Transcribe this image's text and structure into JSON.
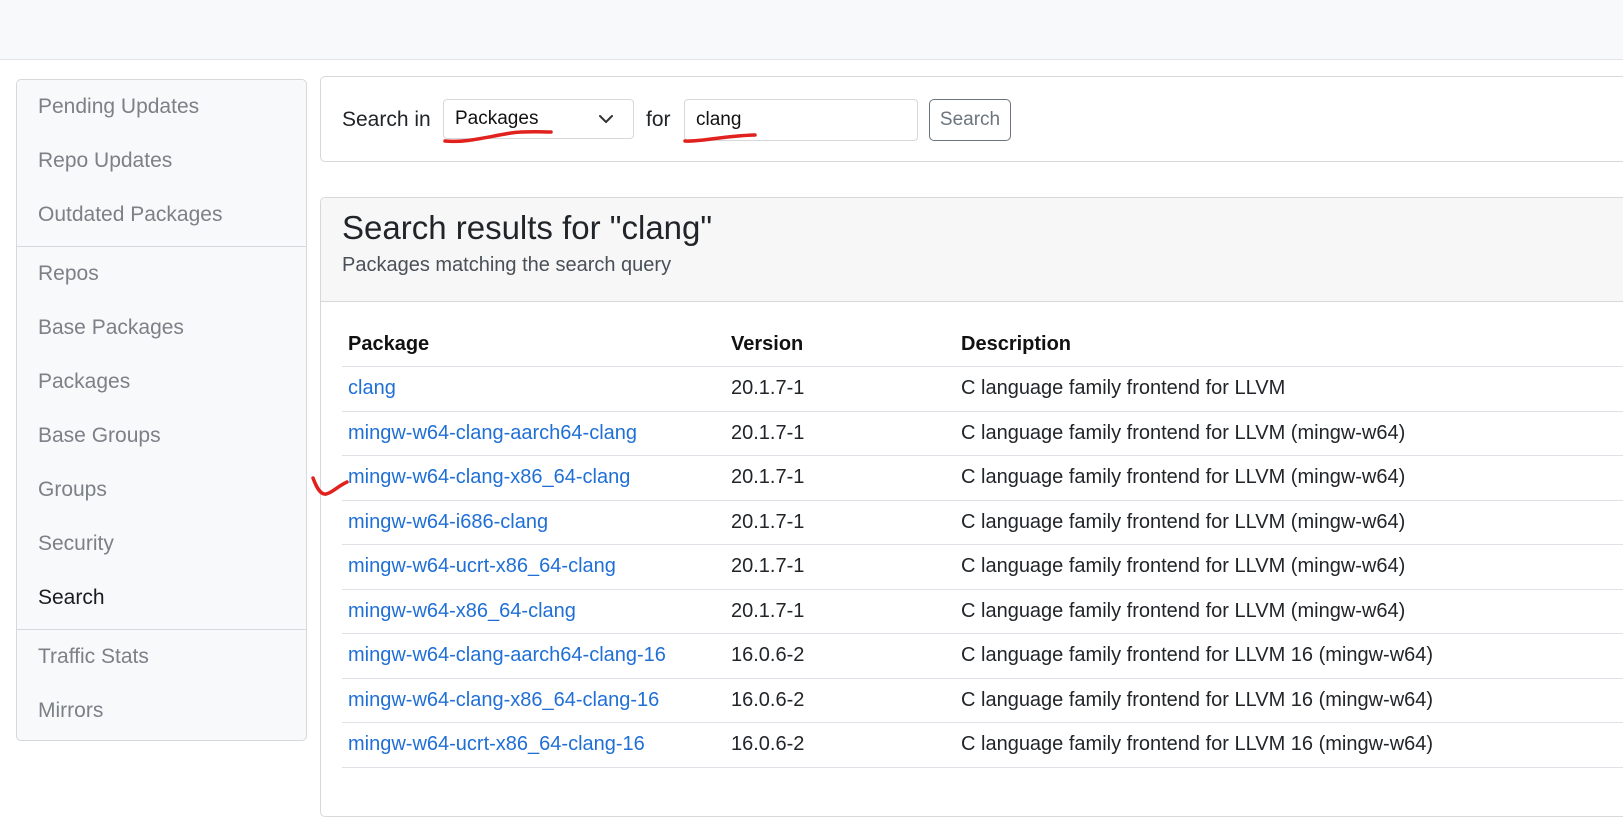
{
  "sidebar": {
    "groups": [
      {
        "items": [
          {
            "label": "Pending Updates"
          },
          {
            "label": "Repo Updates"
          },
          {
            "label": "Outdated Packages"
          }
        ]
      },
      {
        "items": [
          {
            "label": "Repos"
          },
          {
            "label": "Base Packages"
          },
          {
            "label": "Packages"
          },
          {
            "label": "Base Groups"
          },
          {
            "label": "Groups"
          },
          {
            "label": "Security"
          },
          {
            "label": "Search"
          }
        ]
      },
      {
        "items": [
          {
            "label": "Traffic Stats"
          },
          {
            "label": "Mirrors"
          }
        ]
      }
    ],
    "active": "Search"
  },
  "search": {
    "label_in": "Search in",
    "select_value": "Packages",
    "label_for": "for",
    "query": "clang",
    "button_label": "Search"
  },
  "results": {
    "title": "Search results for \"clang\"",
    "subtitle": "Packages matching the search query",
    "columns": [
      "Package",
      "Version",
      "Description"
    ],
    "rows": [
      {
        "package": "clang",
        "version": "20.1.7-1",
        "description": "C language family frontend for LLVM"
      },
      {
        "package": "mingw-w64-clang-aarch64-clang",
        "version": "20.1.7-1",
        "description": "C language family frontend for LLVM (mingw-w64)"
      },
      {
        "package": "mingw-w64-clang-x86_64-clang",
        "version": "20.1.7-1",
        "description": "C language family frontend for LLVM (mingw-w64)"
      },
      {
        "package": "mingw-w64-i686-clang",
        "version": "20.1.7-1",
        "description": "C language family frontend for LLVM (mingw-w64)"
      },
      {
        "package": "mingw-w64-ucrt-x86_64-clang",
        "version": "20.1.7-1",
        "description": "C language family frontend for LLVM (mingw-w64)"
      },
      {
        "package": "mingw-w64-x86_64-clang",
        "version": "20.1.7-1",
        "description": "C language family frontend for LLVM (mingw-w64)"
      },
      {
        "package": "mingw-w64-clang-aarch64-clang-16",
        "version": "16.0.6-2",
        "description": "C language family frontend for LLVM 16 (mingw-w64)"
      },
      {
        "package": "mingw-w64-clang-x86_64-clang-16",
        "version": "16.0.6-2",
        "description": "C language family frontend for LLVM 16 (mingw-w64)"
      },
      {
        "package": "mingw-w64-ucrt-x86_64-clang-16",
        "version": "16.0.6-2",
        "description": "C language family frontend for LLVM 16 (mingw-w64)"
      }
    ]
  },
  "colors": {
    "link": "#1f6fd6",
    "annotation": "#e0211d",
    "muted_nav": "#7b8187"
  },
  "icons": {
    "select_chevron": "chevron-down-icon"
  }
}
